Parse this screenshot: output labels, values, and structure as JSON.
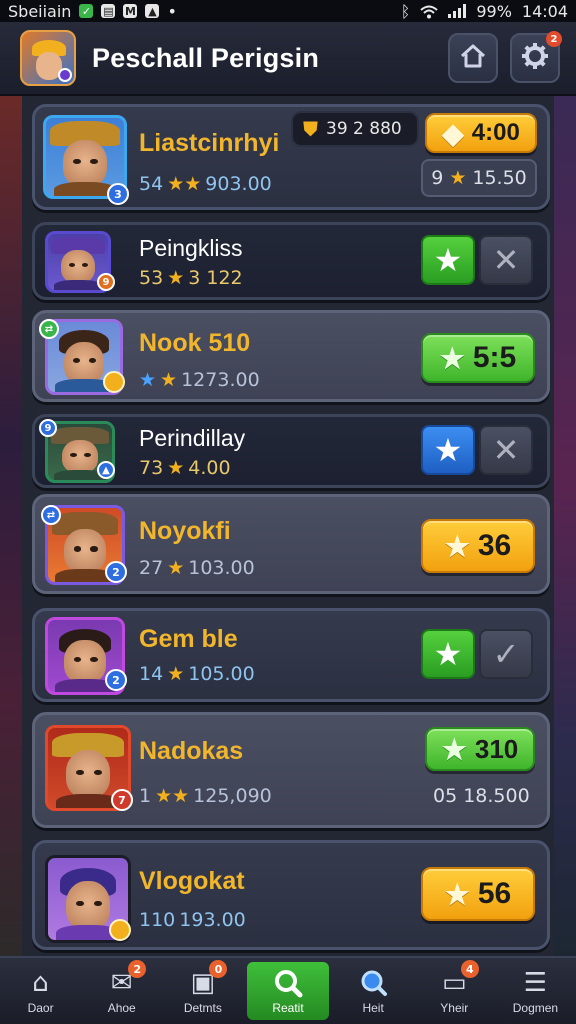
{
  "status_bar": {
    "carrier": "Sbeiiain",
    "battery": "99%",
    "time": "14:04"
  },
  "header": {
    "title": "Peschall Perigsin",
    "notification_count": "2"
  },
  "top_chip": {
    "value": "39 2 880"
  },
  "players": [
    {
      "name": "Liastcinrhyi",
      "name_color": "#f2b62c",
      "stats_prefix": "54",
      "stats_value": "903.00",
      "level": "3",
      "action": {
        "type": "pill",
        "color": "orange",
        "value": "4:00"
      },
      "sub_pill": {
        "left": "9",
        "value": "15.50"
      }
    },
    {
      "name": "Peingkliss",
      "name_color": "#ffffff",
      "stats_prefix": "53",
      "stats_value": "3 122",
      "level": "9",
      "action": {
        "type": "buttons",
        "primary": "green",
        "secondary": "grey",
        "secondary_glyph": "✕"
      }
    },
    {
      "name": "Nook 510",
      "name_color": "#f2b62c",
      "stats_prefix": "",
      "stats_value": "1273.00",
      "level": "",
      "action": {
        "type": "pill",
        "color": "green",
        "value": "5:5"
      }
    },
    {
      "name": "Perindillay",
      "name_color": "#ffffff",
      "stats_prefix": "73",
      "stats_value": "4.00",
      "level": "9",
      "action": {
        "type": "buttons",
        "primary": "blue",
        "secondary": "grey",
        "secondary_glyph": "✕"
      }
    },
    {
      "name": "Noyokfi",
      "name_color": "#f2b62c",
      "stats_prefix": "27",
      "stats_value": "103.00",
      "level": "2",
      "action": {
        "type": "pill",
        "color": "orange",
        "value": "36"
      }
    },
    {
      "name": "Gem ble",
      "name_color": "#f2b62c",
      "stats_prefix": "14",
      "stats_value": "105.00",
      "level": "2",
      "action": {
        "type": "buttons",
        "primary": "green",
        "secondary": "grey",
        "secondary_glyph": "✓"
      }
    },
    {
      "name": "Nadokas",
      "name_color": "#f2b62c",
      "stats_prefix": "1",
      "stats_value": "125,090",
      "level": "7",
      "action": {
        "type": "pill",
        "color": "green",
        "value": "310"
      },
      "sub_text": "05 18.500"
    },
    {
      "name": "Vlogokat",
      "name_color": "#f2b62c",
      "stats_prefix": "110",
      "stats_value": "193.00",
      "level": "",
      "action": {
        "type": "pill",
        "color": "orange",
        "value": "56"
      }
    }
  ],
  "bottom_nav": [
    {
      "label": "Daor",
      "icon": "home-icon",
      "badge": ""
    },
    {
      "label": "Ahoe",
      "icon": "chat-icon",
      "badge": "2"
    },
    {
      "label": "Detmts",
      "icon": "bag-icon",
      "badge": "0"
    },
    {
      "label": "Reatit",
      "icon": "search-icon",
      "badge": "",
      "active": true
    },
    {
      "label": "Heit",
      "icon": "magnifier-icon",
      "badge": ""
    },
    {
      "label": "Yheir",
      "icon": "card-icon",
      "badge": "4"
    },
    {
      "label": "Dogmen",
      "icon": "menu-icon",
      "badge": ""
    }
  ]
}
